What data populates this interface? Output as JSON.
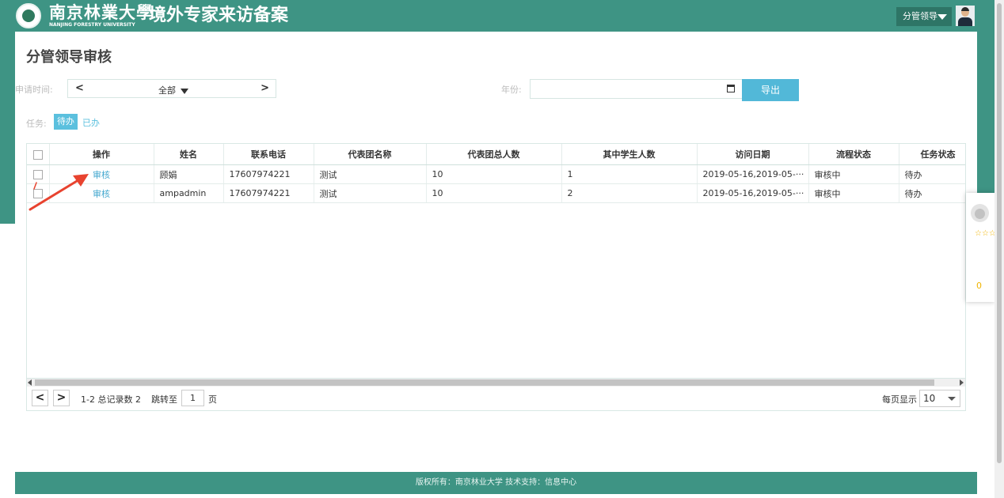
{
  "header": {
    "university_name": "南京林業大學",
    "university_name_en": "NANJING FORESTRY UNIVERSITY",
    "app_title": "境外专家来访备案",
    "role_button_label": "分管领导"
  },
  "page": {
    "title": "分管领导审核"
  },
  "filters": {
    "apply_time_label": "申请时间:",
    "prev_label": "<",
    "next_label": ">",
    "period_value": "全部",
    "year_label": "年份:",
    "year_value": "",
    "export_label": "导出",
    "task_label": "任务:",
    "task_tabs": [
      "待办",
      "已办"
    ]
  },
  "table": {
    "columns": [
      "",
      "操作",
      "姓名",
      "联系电话",
      "代表团名称",
      "代表团总人数",
      "其中学生人数",
      "访问日期",
      "流程状态",
      "任务状态"
    ],
    "rows": [
      {
        "action": "审核",
        "name": "顾娟",
        "phone": "17607974221",
        "delegation": "测试",
        "total": "10",
        "students": "1",
        "visit_date": "2019-05-16,2019-05-···",
        "flow_status": "审核中",
        "task_status": "待办"
      },
      {
        "action": "审核",
        "name": "ampadmin",
        "phone": "17607974221",
        "delegation": "测试",
        "total": "10",
        "students": "2",
        "visit_date": "2019-05-16,2019-05-···",
        "flow_status": "审核中",
        "task_status": "待办"
      }
    ]
  },
  "pager": {
    "prev": "<",
    "next": ">",
    "summary": "1-2 总记录数 2",
    "jump_label": "跳转至",
    "jump_value": "1",
    "page_unit": "页",
    "per_page_label": "每页显示",
    "per_page_value": "10"
  },
  "footer": {
    "text": "版权所有：南京林业大学   技术支持：信息中心"
  },
  "side_widget": {
    "stars": "☆☆☆☆☆",
    "count": "0"
  },
  "colors": {
    "brand": "#3e9484",
    "accent": "#5bc0de",
    "link": "#44a8cf",
    "annotation_arrow": "#e8432f"
  },
  "icons": [
    "university-logo-icon",
    "caret-down-icon",
    "user-avatar-icon",
    "calendar-icon",
    "checkbox-icon",
    "annotation-arrow-icon",
    "star-icon"
  ]
}
